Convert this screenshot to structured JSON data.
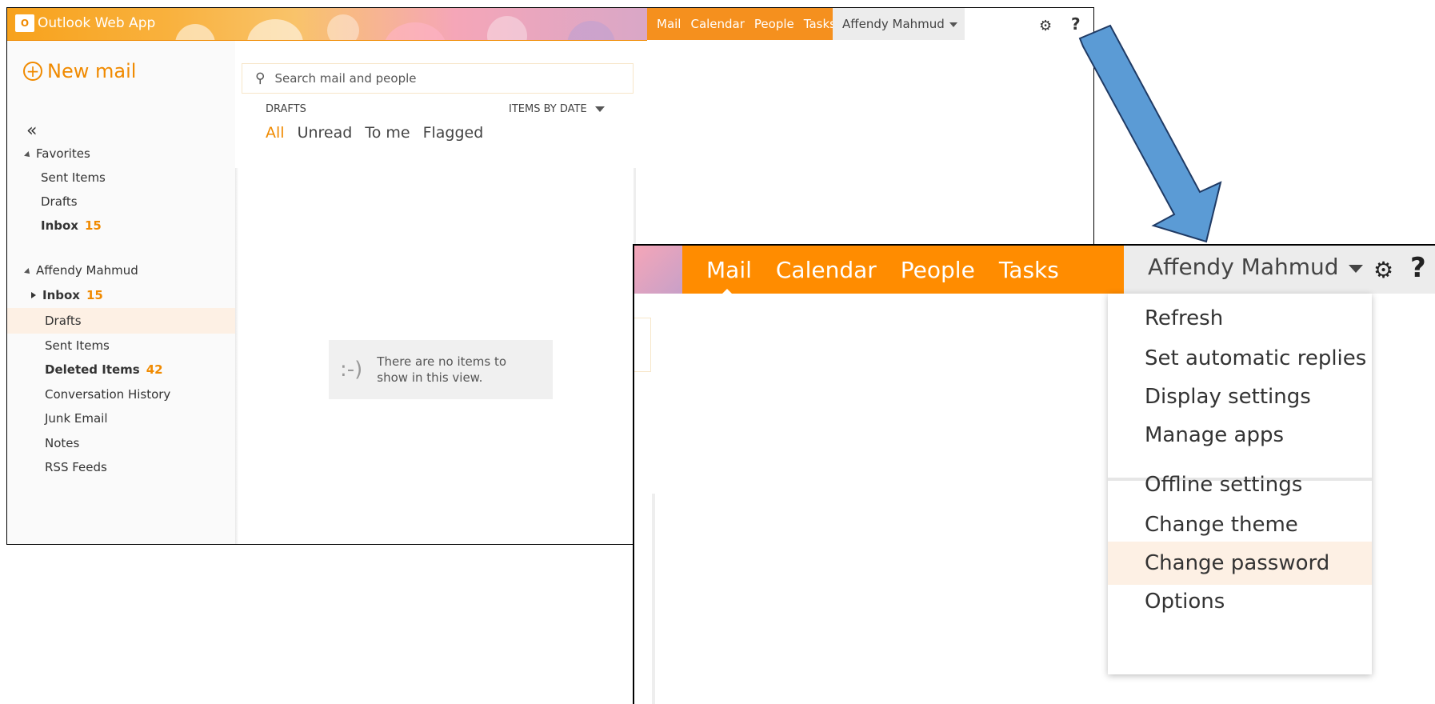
{
  "app": {
    "title": "Outlook Web App",
    "logo_mark": "O"
  },
  "nav": {
    "items": [
      "Mail",
      "Calendar",
      "People",
      "Tasks"
    ]
  },
  "user": {
    "name": "Affendy Mahmud"
  },
  "icons": {
    "settings": "gear-icon",
    "help": "?",
    "collapse": "«"
  },
  "sidebar": {
    "new_mail": "New mail",
    "favorites_header": "Favorites",
    "favorites": [
      {
        "label": "Sent Items",
        "count": ""
      },
      {
        "label": "Drafts",
        "count": ""
      },
      {
        "label": "Inbox",
        "count": "15"
      }
    ],
    "account_header": "Affendy Mahmud",
    "folders": [
      {
        "label": "Inbox",
        "count": "15"
      },
      {
        "label": "Drafts",
        "count": ""
      },
      {
        "label": "Sent Items",
        "count": ""
      },
      {
        "label": "Deleted Items",
        "count": "42"
      },
      {
        "label": "Conversation History",
        "count": ""
      },
      {
        "label": "Junk Email",
        "count": ""
      },
      {
        "label": "Notes",
        "count": ""
      },
      {
        "label": "RSS Feeds",
        "count": ""
      }
    ]
  },
  "list": {
    "search_placeholder": "Search mail and people",
    "folder_label": "DRAFTS",
    "sort_label": "ITEMS BY DATE",
    "filters": [
      "All",
      "Unread",
      "To me",
      "Flagged"
    ],
    "empty_face": ":-)",
    "empty_message": "There are no items to show in this view."
  },
  "settings_menu": {
    "items": [
      "Refresh",
      "Set automatic replies",
      "Display settings",
      "Manage apps",
      "Offline settings",
      "Change theme",
      "Change password",
      "Options"
    ],
    "highlighted": "Change password"
  },
  "colors": {
    "accent": "#f08a00",
    "nav_orange": "#ff8c00",
    "arrow": "#5b9bd5"
  }
}
